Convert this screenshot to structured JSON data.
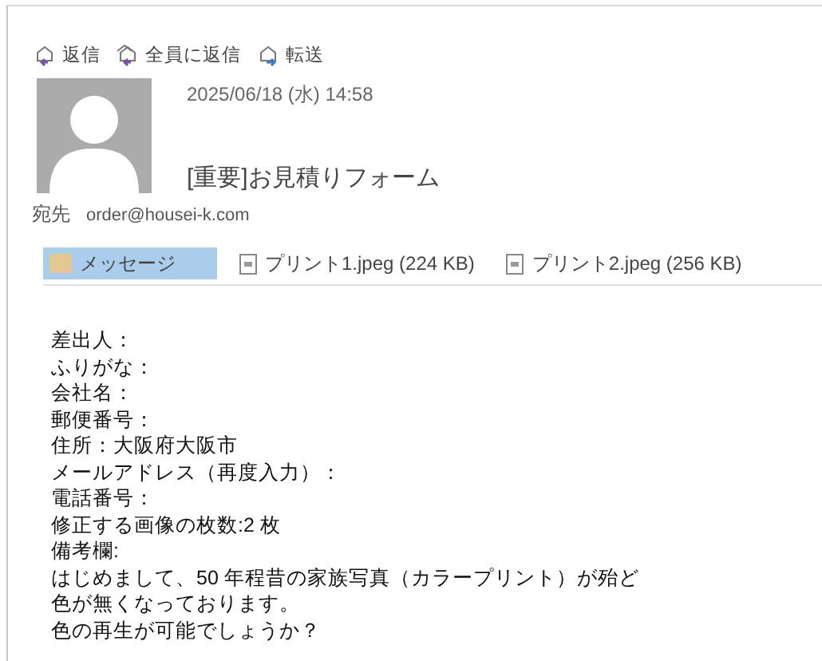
{
  "toolbar": [
    {
      "label": "返信",
      "kind": "reply"
    },
    {
      "label": "全員に返信",
      "kind": "reply_all"
    },
    {
      "label": "転送",
      "kind": "forward"
    }
  ],
  "header": {
    "date": "2025/06/18 (水) 14:58",
    "subject": "[重要]お見積りフォーム",
    "to_label": "宛先",
    "to": "order@housei-k.com"
  },
  "attachments": [
    {
      "label": "メッセージ",
      "kind": "message",
      "selected": true
    },
    {
      "label": "プリント1.jpeg (224 KB)",
      "kind": "file",
      "selected": false
    },
    {
      "label": "プリント2.jpeg (256 KB)",
      "kind": "file",
      "selected": false
    }
  ],
  "body": [
    "差出人：",
    "ふりがな：",
    "会社名：",
    "郵便番号：",
    "住所：大阪府大阪市",
    "メールアドレス（再度入力）：",
    "電話番号：",
    "修正する画像の枚数:2 枚",
    "備考欄:",
    "はじめまして、50 年程昔の家族写真（カラープリント）が殆ど",
    "色が無くなっております。",
    "色の再生が可能でしょうか？"
  ]
}
